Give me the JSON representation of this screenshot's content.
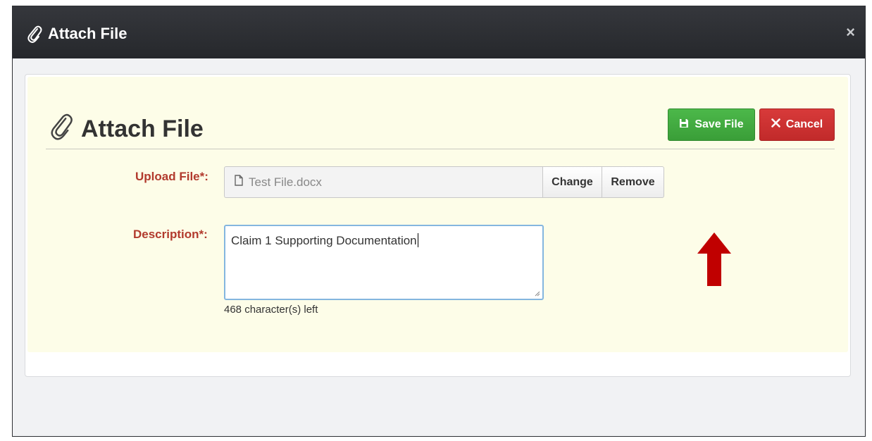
{
  "modal": {
    "title": "Attach File",
    "close_label": "×"
  },
  "panel": {
    "title": "Attach File",
    "save_label": "Save File",
    "cancel_label": "Cancel"
  },
  "upload": {
    "label": "Upload File*:",
    "filename": "Test File.docx",
    "change_label": "Change",
    "remove_label": "Remove"
  },
  "description": {
    "label": "Description*:",
    "value": "Claim 1 Supporting Documentation",
    "char_count": "468 character(s) left"
  },
  "colors": {
    "header_bg": "#2c2e33",
    "panel_bg": "#fdfde8",
    "save_green": "#43ab41",
    "cancel_red": "#cc3333",
    "label_red": "#b23a2d",
    "annotation_arrow": "#c00000"
  },
  "icons": {
    "header": "paperclip-icon",
    "panel_title": "paperclip-icon",
    "save": "save-disk-icon",
    "cancel": "x-icon",
    "file": "document-icon",
    "annotation": "up-arrow-icon"
  }
}
